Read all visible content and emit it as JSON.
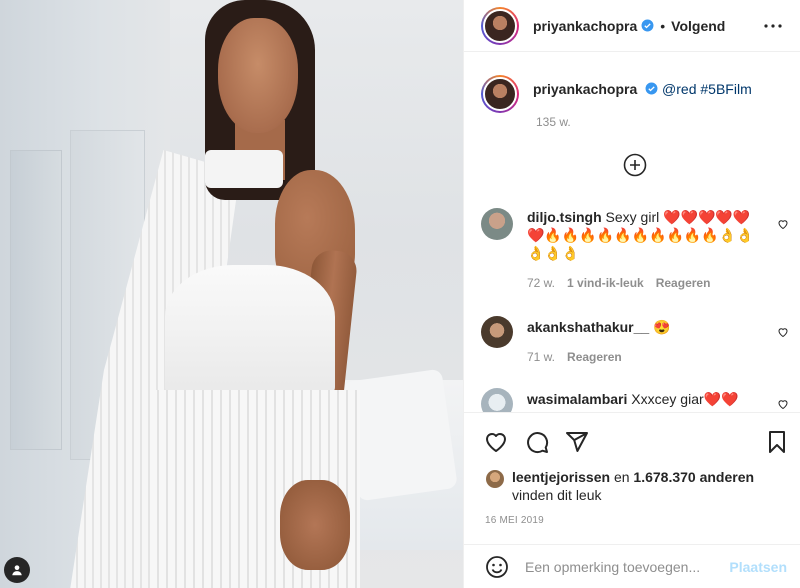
{
  "post": {
    "author": "priyankachopra",
    "follow_status": "Volgend",
    "caption_mention": "@red",
    "caption_hashtag": "#5BFilm",
    "caption_age": "135 w."
  },
  "comments": [
    {
      "user": "diljo.tsingh",
      "text": "Sexy girl ❤️❤️❤️❤️❤️❤️🔥🔥🔥🔥🔥🔥🔥🔥🔥🔥👌👌👌👌👌",
      "age": "72 w.",
      "likes": "1 vind-ik-leuk",
      "reply": "Reageren"
    },
    {
      "user": "akankshathakur__",
      "text": "😍",
      "age": "71 w.",
      "reply": "Reageren"
    },
    {
      "user": "wasimalambari",
      "text": "Xxxcey giar❤️❤️"
    }
  ],
  "likes": {
    "liker": "leentjejorissen",
    "connector": "en",
    "count": "1.678.370",
    "others": "anderen",
    "suffix": "vinden dit leuk"
  },
  "date": "16 MEI 2019",
  "add_comment": {
    "placeholder": "Een opmerking toevoegen...",
    "post_label": "Plaatsen"
  },
  "colors": {
    "verified_blue": "#3897f0",
    "link": "#00376b",
    "muted": "#8e8e8e",
    "post_disabled": "#b2dffc"
  }
}
